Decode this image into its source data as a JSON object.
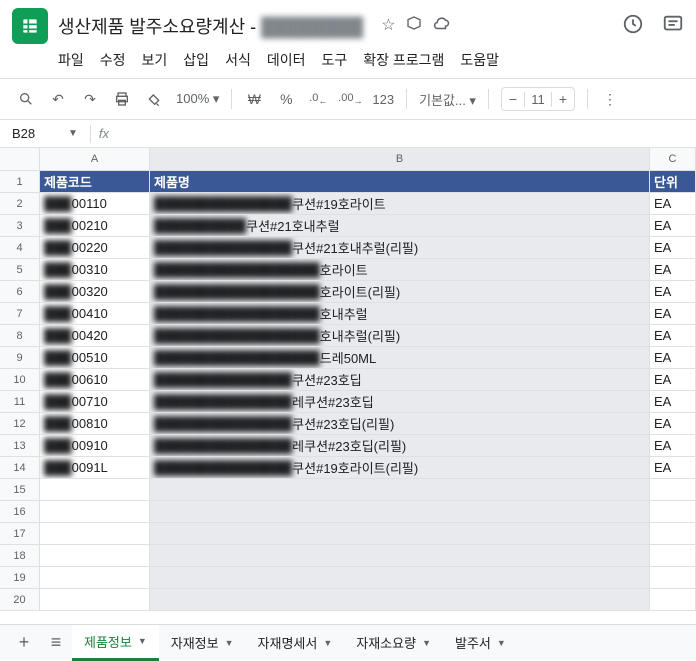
{
  "doc": {
    "title": "생산제품 발주소요량계산 - ",
    "title_blur": "████████"
  },
  "menu": [
    "파일",
    "수정",
    "보기",
    "삽입",
    "서식",
    "데이터",
    "도구",
    "확장 프로그램",
    "도움말"
  ],
  "toolbar": {
    "zoom": "100%",
    "currency": "₩",
    "percent": "%",
    "dec_dn": ".0",
    "dec_up": ".00",
    "num": "123",
    "font": "기본값...",
    "size": "11"
  },
  "namebox": "B28",
  "columns": [
    "A",
    "B",
    "C"
  ],
  "headers": {
    "a": "제품코드",
    "b": "제품명",
    "c": "단위"
  },
  "rows": [
    {
      "a": "███00110",
      "b": "███████████████쿠션#19호라이트",
      "c": "EA"
    },
    {
      "a": "███00210",
      "b": "██████████쿠션#21호내추럴",
      "c": "EA"
    },
    {
      "a": "███00220",
      "b": "███████████████쿠션#21호내추럴(리필)",
      "c": "EA"
    },
    {
      "a": "███00310",
      "b": "██████████████████호라이트",
      "c": "EA"
    },
    {
      "a": "███00320",
      "b": "██████████████████호라이트(리필)",
      "c": "EA"
    },
    {
      "a": "███00410",
      "b": "██████████████████호내추럴",
      "c": "EA"
    },
    {
      "a": "███00420",
      "b": "██████████████████호내추럴(리필)",
      "c": "EA"
    },
    {
      "a": "███00510",
      "b": "██████████████████드레50ML",
      "c": "EA"
    },
    {
      "a": "███00610",
      "b": "███████████████쿠션#23호딥",
      "c": "EA"
    },
    {
      "a": "███00710",
      "b": "███████████████레쿠션#23호딥",
      "c": "EA"
    },
    {
      "a": "███00810",
      "b": "███████████████쿠션#23호딥(리필)",
      "c": "EA"
    },
    {
      "a": "███00910",
      "b": "███████████████레쿠션#23호딥(리필)",
      "c": "EA"
    },
    {
      "a": "███0091L",
      "b": "███████████████쿠션#19호라이트(리필)",
      "c": "EA"
    }
  ],
  "tabs": [
    "제품정보",
    "자재정보",
    "자재명세서",
    "자재소요량",
    "발주서"
  ]
}
